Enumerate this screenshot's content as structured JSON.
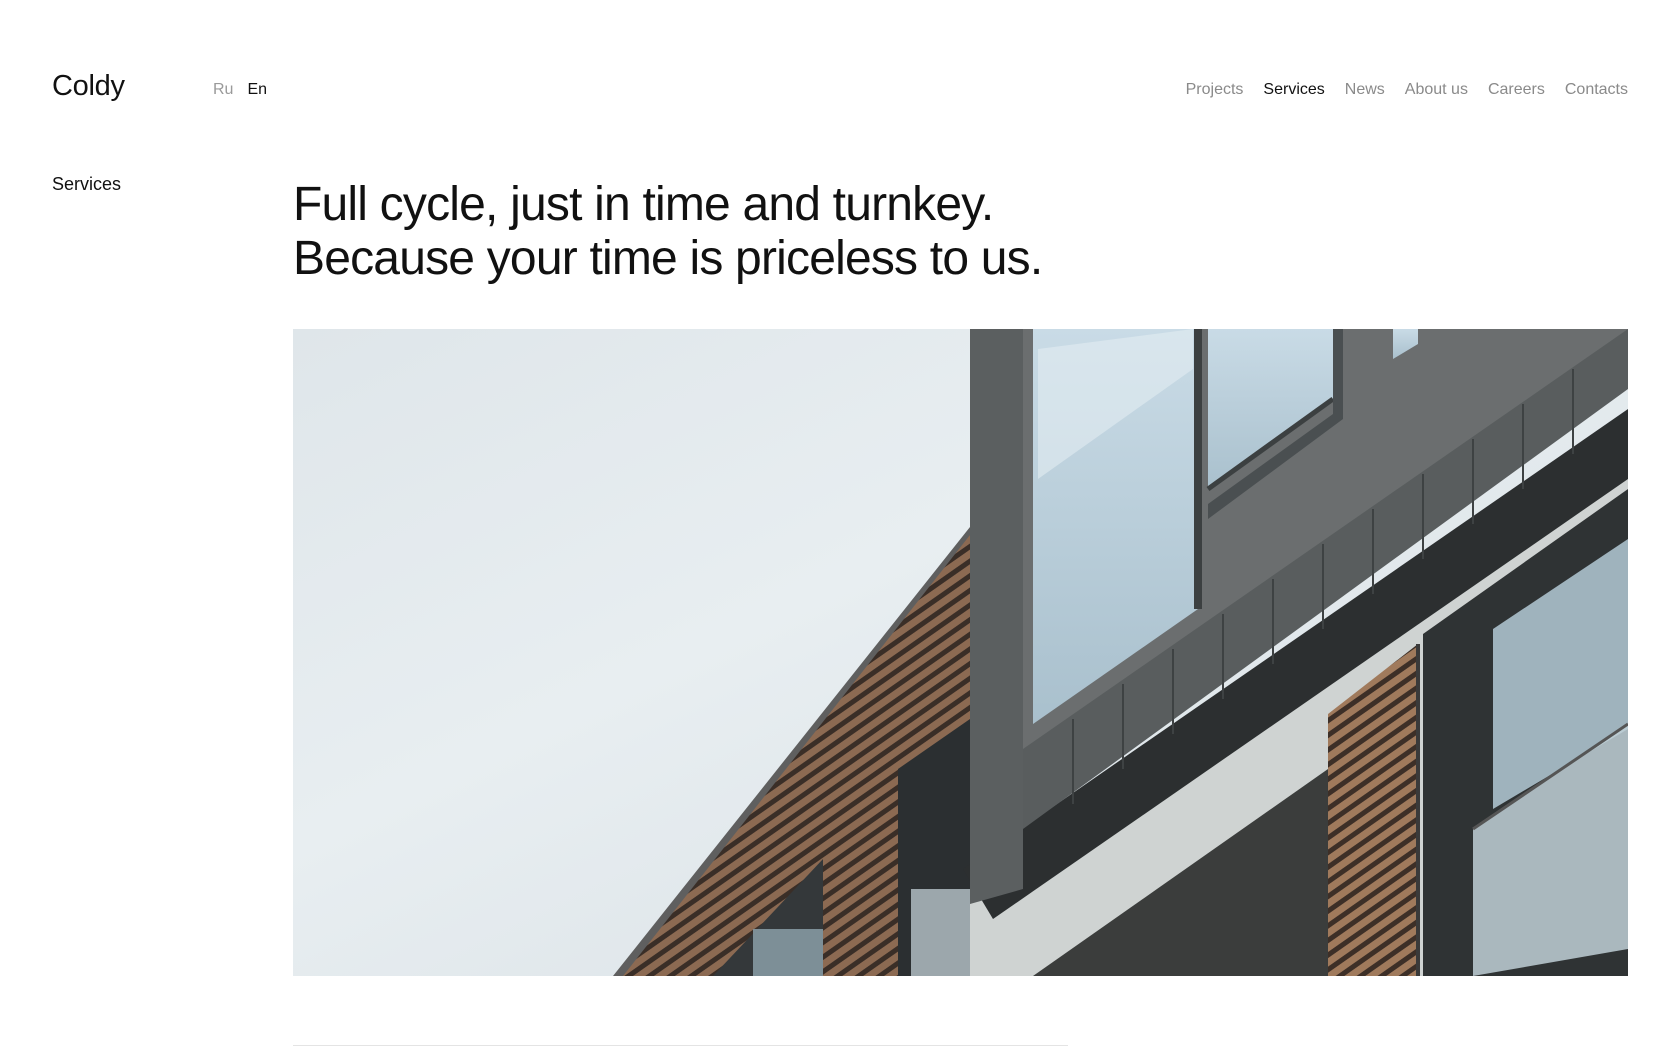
{
  "header": {
    "logo": "Coldy",
    "languages": [
      {
        "label": "Ru",
        "active": false
      },
      {
        "label": "En",
        "active": true
      }
    ],
    "nav": [
      {
        "label": "Projects",
        "active": false
      },
      {
        "label": "Services",
        "active": true
      },
      {
        "label": "News",
        "active": false
      },
      {
        "label": "About us",
        "active": false
      },
      {
        "label": "Careers",
        "active": false
      },
      {
        "label": "Contacts",
        "active": false
      }
    ]
  },
  "section": {
    "label": "Services"
  },
  "main": {
    "headline_line1": "Full cycle, just in time and turnkey.",
    "headline_line2": "Because your time is priceless to us."
  },
  "colors": {
    "text": "#111111",
    "muted": "#8a8a8a",
    "background": "#ffffff"
  }
}
